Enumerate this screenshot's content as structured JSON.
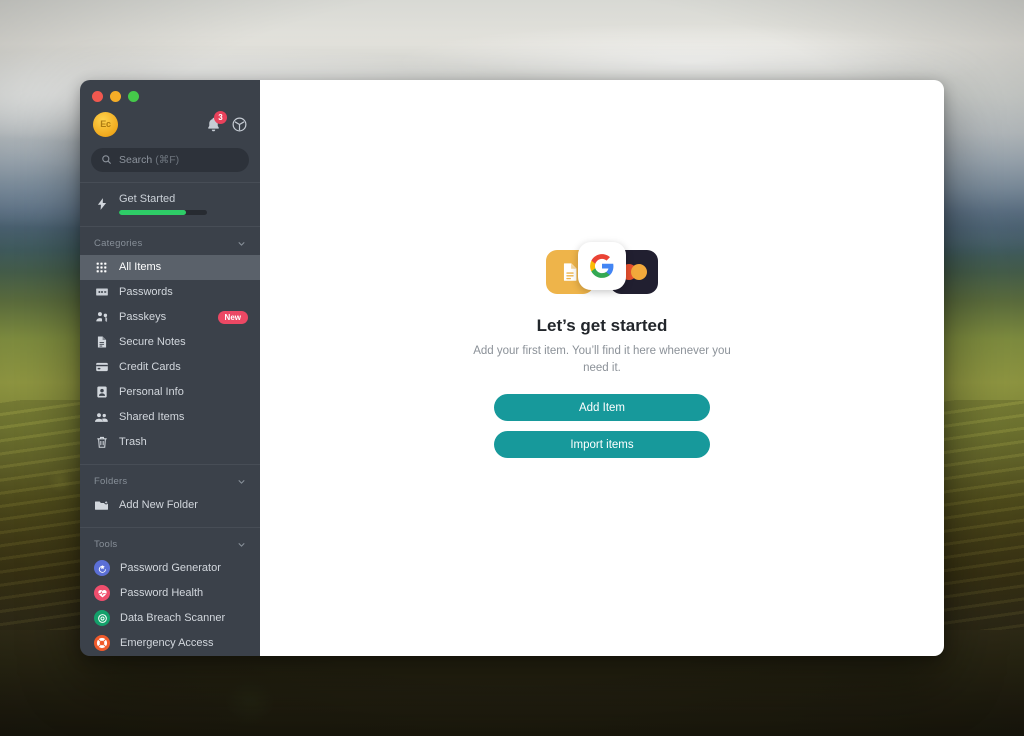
{
  "window": {
    "traffic_lights": [
      "close",
      "minimize",
      "zoom"
    ],
    "colors": {
      "close": "#f1584f",
      "minimize": "#f5ad27",
      "zoom": "#45c94a"
    }
  },
  "sidebar": {
    "account": {
      "avatar_initials": "Ec",
      "avatar_color": "#f0a81c"
    },
    "top_actions": [
      {
        "name": "notifications-bell-icon",
        "badge": "3",
        "badge_color": "#e8415b"
      },
      {
        "name": "settings-icon"
      }
    ],
    "search": {
      "placeholder_label": "Search",
      "shortcut": "(⌘F)"
    },
    "get_started": {
      "label": "Get Started",
      "progress_percent": 76,
      "progress_color": "#2ecc67"
    },
    "sections": [
      {
        "title": "Categories",
        "collapsed": false,
        "items": [
          {
            "label": "All Items",
            "icon": "grid-icon",
            "selected": true
          },
          {
            "label": "Passwords",
            "icon": "password-icon",
            "selected": false
          },
          {
            "label": "Passkeys",
            "icon": "passkey-icon",
            "selected": false,
            "badge": "New"
          },
          {
            "label": "Secure Notes",
            "icon": "note-icon",
            "selected": false
          },
          {
            "label": "Credit Cards",
            "icon": "credit-card-icon",
            "selected": false
          },
          {
            "label": "Personal Info",
            "icon": "person-id-icon",
            "selected": false
          },
          {
            "label": "Shared Items",
            "icon": "people-icon",
            "selected": false
          },
          {
            "label": "Trash",
            "icon": "trash-icon",
            "selected": false
          }
        ]
      },
      {
        "title": "Folders",
        "collapsed": false,
        "items": [
          {
            "label": "Add New Folder",
            "icon": "folder-plus-icon",
            "selected": false
          }
        ]
      },
      {
        "title": "Tools",
        "collapsed": false,
        "items": [
          {
            "label": "Password Generator",
            "icon": "password-generator-icon",
            "color": "#5b6fd6",
            "selected": false
          },
          {
            "label": "Password Health",
            "icon": "heart-pulse-icon",
            "color": "#ef4e6d",
            "selected": false
          },
          {
            "label": "Data Breach Scanner",
            "icon": "radar-scan-icon",
            "color": "#14a06a",
            "selected": false
          },
          {
            "label": "Emergency Access",
            "icon": "life-ring-icon",
            "color": "#f05a2b",
            "selected": false
          }
        ]
      }
    ]
  },
  "main": {
    "empty_state": {
      "title": "Let’s get started",
      "subtitle": "Add your first item. You’ll find it here whenever you need it.",
      "primary_button": "Add Item",
      "secondary_button": "Import items",
      "button_color": "#17999b",
      "illustration_cards": [
        {
          "name": "secure-note-card",
          "color": "#eeb44a"
        },
        {
          "name": "google-login-card",
          "color": "#ffffff"
        },
        {
          "name": "mastercard-card",
          "color": "#211f30"
        }
      ]
    }
  }
}
